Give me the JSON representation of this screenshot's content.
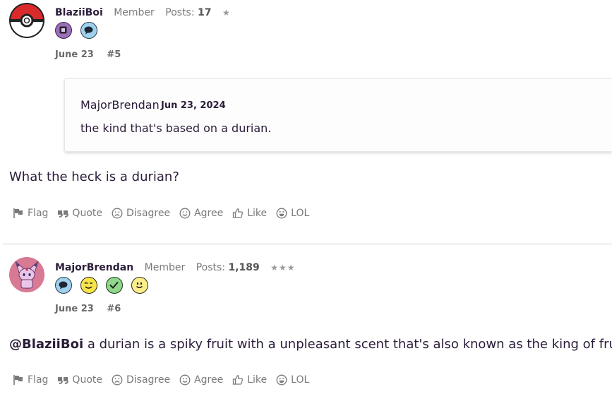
{
  "posts": [
    {
      "username": "BlaziiBoi",
      "role": "Member",
      "posts_label": "Posts:",
      "posts_count": "17",
      "stars": "★",
      "badges": [
        "chip-badge-icon",
        "speech-bubble-badge-icon"
      ],
      "date": "June 23",
      "post_number": "#5",
      "quote": {
        "author": "MajorBrendan",
        "date": "Jun 23, 2024",
        "text": "the kind that's based on a durian."
      },
      "body": "What the heck is a durian?"
    },
    {
      "username": "MajorBrendan",
      "role": "Member",
      "posts_label": "Posts:",
      "posts_count": "1,189",
      "stars": "★★★",
      "badges": [
        "speech-bubble-badge-icon",
        "wink-face-badge-icon",
        "checkmark-badge-icon",
        "smile-face-badge-icon"
      ],
      "date": "June 23",
      "post_number": "#6",
      "mention": "@BlaziiBoi",
      "body": " a durian is a spiky fruit with a unpleasant scent that's also known as the king of fruits."
    }
  ],
  "actions": {
    "flag": "Flag",
    "quote": "Quote",
    "disagree": "Disagree",
    "agree": "Agree",
    "like": "Like",
    "lol": "LOL"
  },
  "colors": {
    "text": "#2b1d3a",
    "muted": "#7a7a7a",
    "pokeball_red": "#d92b2b",
    "espeon_pink": "#d97a95"
  }
}
